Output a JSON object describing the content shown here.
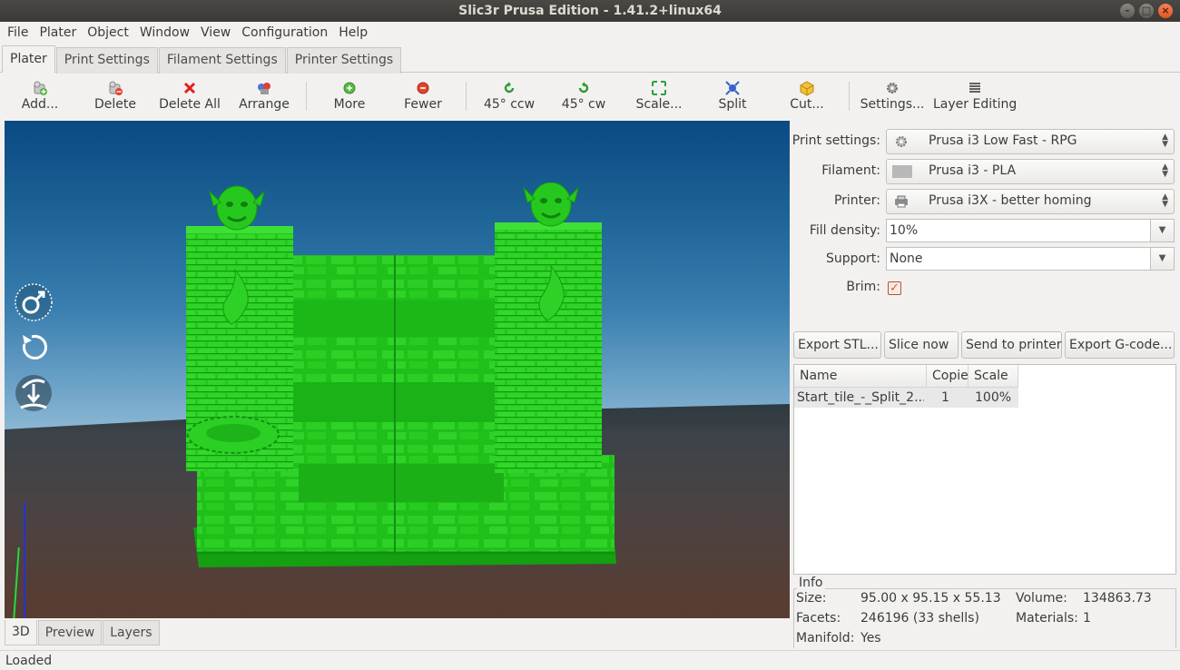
{
  "window": {
    "title": "Slic3r Prusa Edition - 1.41.2+linux64"
  },
  "menu": [
    "File",
    "Plater",
    "Object",
    "Window",
    "View",
    "Configuration",
    "Help"
  ],
  "tabs": [
    "Plater",
    "Print Settings",
    "Filament Settings",
    "Printer Settings"
  ],
  "toolbar": {
    "add": "Add...",
    "delete": "Delete",
    "delete_all": "Delete All",
    "arrange": "Arrange",
    "more": "More",
    "fewer": "Fewer",
    "rotate_ccw": "45° ccw",
    "rotate_cw": "45° cw",
    "scale": "Scale...",
    "split": "Split",
    "cut": "Cut...",
    "settings": "Settings...",
    "layer_editing": "Layer Editing"
  },
  "view_tabs": [
    "3D",
    "Preview",
    "Layers"
  ],
  "settings": {
    "print_label": "Print settings:",
    "print_value": "Prusa i3 Low Fast - RPG",
    "filament_label": "Filament:",
    "filament_value": "Prusa i3 - PLA",
    "printer_label": "Printer:",
    "printer_value": "Prusa i3X - better homing",
    "fill_label": "Fill density:",
    "fill_value": "10%",
    "support_label": "Support:",
    "support_value": "None",
    "brim_label": "Brim:",
    "brim_checked": true
  },
  "actions": {
    "export_stl": "Export STL...",
    "slice_now": "Slice now",
    "send_to_printer": "Send to printer",
    "export_gcode": "Export G-code..."
  },
  "object_list": {
    "columns": [
      "Name",
      "Copie",
      "Scale"
    ],
    "rows": [
      {
        "name": "Start_tile_-_Split_2...",
        "copies": "1",
        "scale": "100%"
      }
    ]
  },
  "info": {
    "title": "Info",
    "size_label": "Size:",
    "size_value": "95.00 x 95.15 x 55.13",
    "volume_label": "Volume:",
    "volume_value": "134863.73",
    "facets_label": "Facets:",
    "facets_value": "246196 (33 shells)",
    "materials_label": "Materials:",
    "materials_value": "1",
    "manifold_label": "Manifold:",
    "manifold_value": "Yes"
  },
  "status": "Loaded",
  "colors": {
    "model": "#1ec81a",
    "accent": "#e05a1c",
    "bed_sky": "#1f6597"
  }
}
